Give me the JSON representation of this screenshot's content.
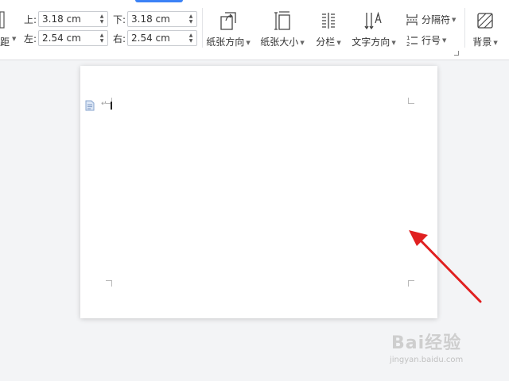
{
  "ribbon": {
    "margins": {
      "top": {
        "label": "上:",
        "value": "3.18 cm"
      },
      "bottom": {
        "label": "下:",
        "value": "3.18 cm"
      },
      "left": {
        "label": "左:",
        "value": "2.54 cm"
      },
      "right": {
        "label": "右:",
        "value": "2.54 cm"
      }
    },
    "left_cut_label": "距",
    "tools": {
      "orientation": "纸张方向",
      "paper_size": "纸张大小",
      "columns": "分栏",
      "text_direction": "文字方向",
      "separator": "分隔符",
      "line_number": "行号",
      "background": "背景"
    }
  },
  "watermark": {
    "brand": "Bai经验",
    "url": "jingyan.baidu.com"
  },
  "annotation": {
    "arrow_color": "#e02020"
  }
}
